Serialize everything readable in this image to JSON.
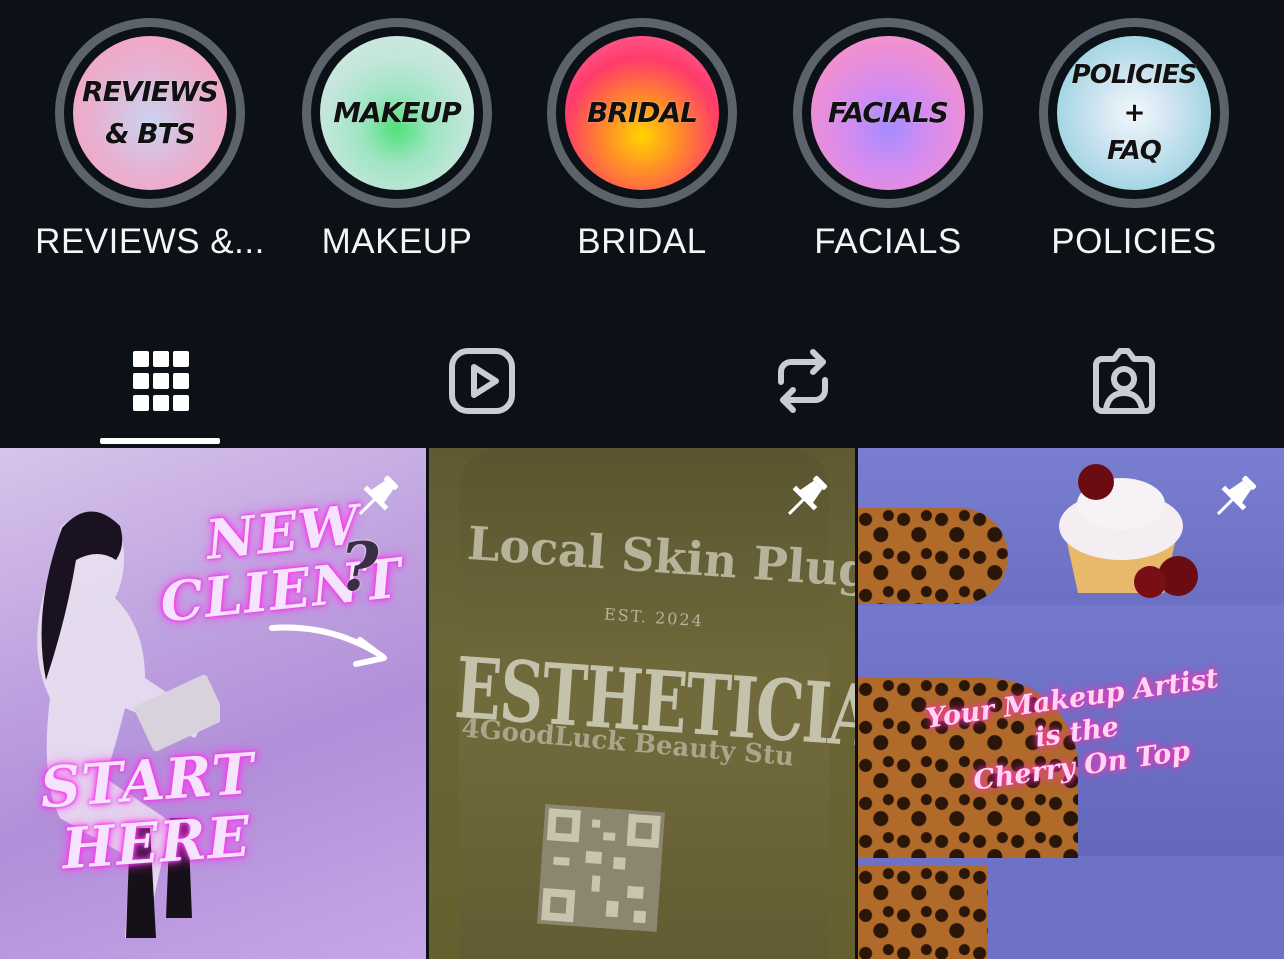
{
  "highlights": [
    {
      "cover_lines": [
        "REVIEWS",
        "& BTS"
      ],
      "title": "REVIEWS &...",
      "cover_class": "c-reviews"
    },
    {
      "cover_lines": [
        "MAKEUP"
      ],
      "title": "MAKEUP",
      "cover_class": "c-makeup"
    },
    {
      "cover_lines": [
        "BRIDAL"
      ],
      "title": "BRIDAL",
      "cover_class": "c-bridal"
    },
    {
      "cover_lines": [
        "FACIALS"
      ],
      "title": "FACIALS",
      "cover_class": "c-facials"
    },
    {
      "cover_lines": [
        "POLICIES",
        "+",
        "FAQ"
      ],
      "title": "POLICIES",
      "cover_class": "c-policies"
    }
  ],
  "tabs": [
    {
      "icon": "grid-icon",
      "active": true
    },
    {
      "icon": "reels-play-icon",
      "active": false
    },
    {
      "icon": "repost-icon",
      "active": false
    },
    {
      "icon": "tagged-person-icon",
      "active": false
    }
  ],
  "posts": [
    {
      "pinned": true,
      "overlay_text": [
        "NEW",
        "CLIENT",
        "?",
        "START",
        "HERE"
      ]
    },
    {
      "pinned": true,
      "overlay_text": [
        "Local Skin Plug",
        "EST. 2024",
        "ESTHETICIAN",
        "4GoodLuck Beauty Stu"
      ]
    },
    {
      "pinned": true,
      "overlay_text": [
        "Your Makeup Artist",
        "is the",
        "Cherry On Top"
      ]
    }
  ],
  "colors": {
    "background": "#0b1116",
    "ring": "#5c636b",
    "icon": "#ffffff",
    "icon_inactive": "#c9cdd2"
  }
}
